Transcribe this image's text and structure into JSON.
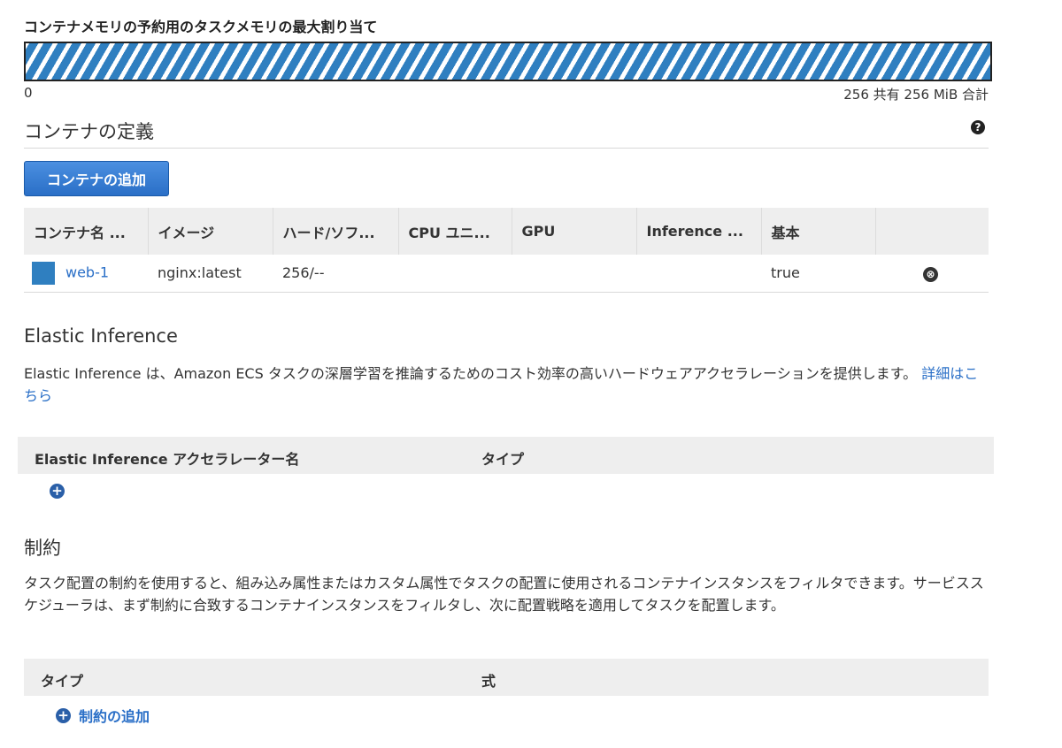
{
  "memory": {
    "title": "コンテナメモリの予約用のタスクメモリの最大割り当て",
    "min_label": "0",
    "max_label": "256 共有 256 MiB 合計",
    "reserved_fraction": 1.0,
    "bar_color": "#2f7fc0"
  },
  "container_definitions": {
    "title": "コンテナの定義",
    "help_icon": "?",
    "add_button": "コンテナの追加",
    "columns": [
      "コンテナ名 ...",
      "イメージ",
      "ハード/ソフ...",
      "CPU ユニ...",
      "GPU",
      "Inference ...",
      "基本",
      ""
    ],
    "rows": [
      {
        "name": "web-1",
        "image": "nginx:latest",
        "memory": "256/--",
        "cpu": "",
        "gpu": "",
        "inference": "",
        "essential": "true",
        "remove_icon": "⊗"
      }
    ]
  },
  "elastic_inference": {
    "title": "Elastic Inference",
    "description": "Elastic Inference は、Amazon ECS タスクの深層学習を推論するためのコスト効率の高いハードウェアアクセラレーションを提供します。",
    "link": "詳細はこちら",
    "col_name": "Elastic Inference アクセラレーター名",
    "col_type": "タイプ",
    "add_icon": "+"
  },
  "constraints": {
    "title": "制約",
    "description": "タスク配置の制約を使用すると、組み込み属性またはカスタム属性でタスクの配置に使用されるコンテナインスタンスをフィルタできます。サービススケジューラは、まず制約に合致するコンテナインスタンスをフィルタし、次に配置戦略を適用してタスクを配置します。",
    "col_type": "タイプ",
    "col_expression": "式",
    "add_label": "制約の追加",
    "add_icon": "+"
  }
}
